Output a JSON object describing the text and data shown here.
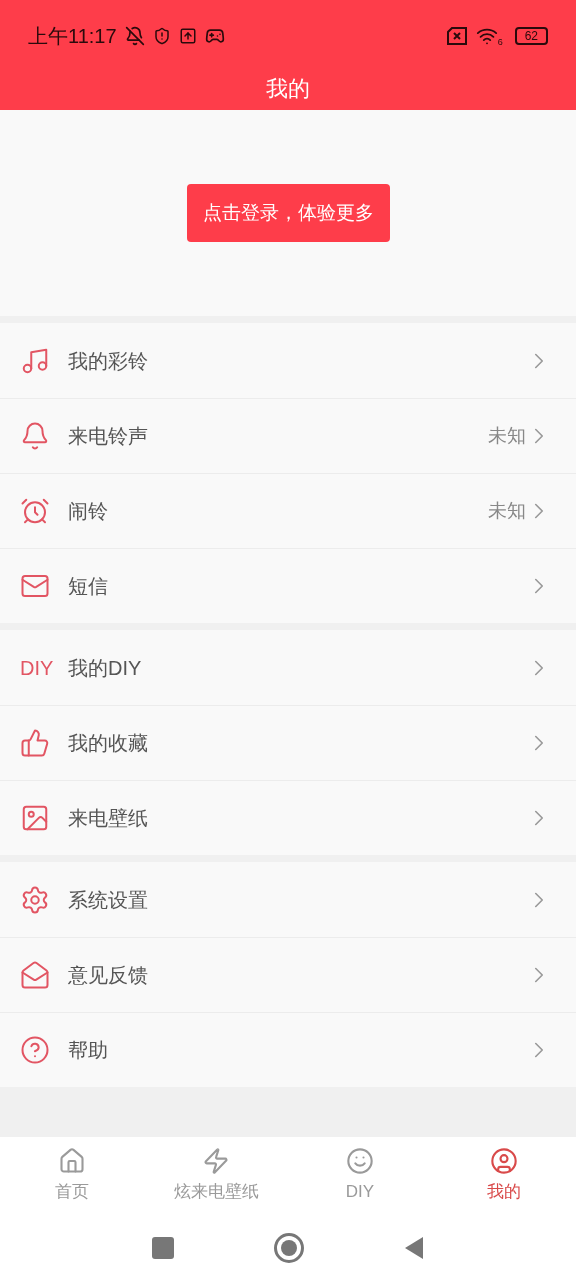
{
  "status_bar": {
    "time": "上午11:17",
    "wifi_badge": "6",
    "battery": "62"
  },
  "header": {
    "title": "我的"
  },
  "login": {
    "button": "点击登录，体验更多"
  },
  "groups": [
    {
      "items": [
        {
          "label": "我的彩铃"
        },
        {
          "label": "来电铃声",
          "value": "未知"
        },
        {
          "label": "闹铃",
          "value": "未知"
        },
        {
          "label": "短信"
        }
      ]
    },
    {
      "items": [
        {
          "label": "我的DIY",
          "icon_text": "DIY"
        },
        {
          "label": "我的收藏"
        },
        {
          "label": "来电壁纸"
        }
      ]
    },
    {
      "items": [
        {
          "label": "系统设置"
        },
        {
          "label": "意见反馈"
        },
        {
          "label": "帮助"
        }
      ]
    }
  ],
  "tabs": [
    {
      "label": "首页",
      "selected": false
    },
    {
      "label": "炫来电壁纸",
      "selected": false
    },
    {
      "label": "DIY",
      "selected": false
    },
    {
      "label": "我的",
      "selected": true
    }
  ]
}
